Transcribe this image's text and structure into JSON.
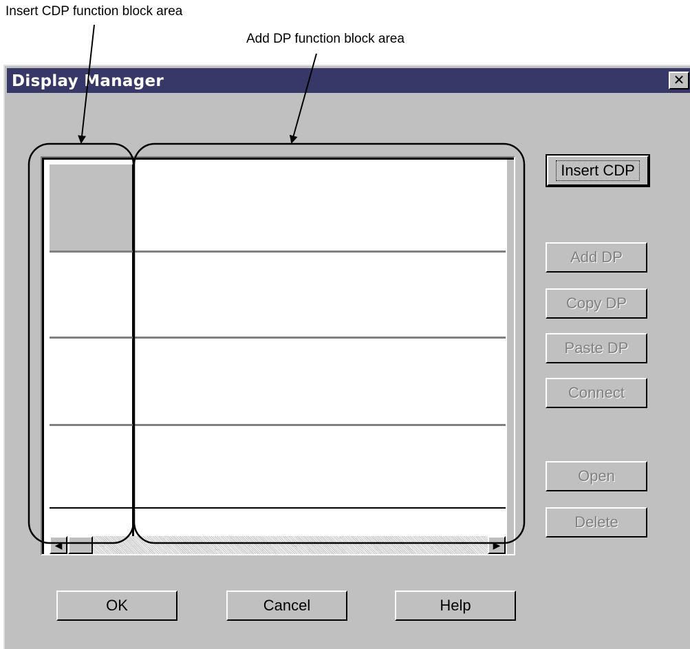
{
  "annotations": {
    "cdp_area": "Insert CDP function block area",
    "dp_area": "Add DP function block area"
  },
  "window": {
    "title": "Display Manager",
    "close_glyph": "✕"
  },
  "buttons": {
    "insert_cdp": "Insert CDP",
    "add_dp": "Add DP",
    "copy_dp": "Copy DP",
    "paste_dp": "Paste DP",
    "connect": "Connect",
    "open": "Open",
    "delete": "Delete",
    "ok": "OK",
    "cancel": "Cancel",
    "help": "Help"
  },
  "scrollbar": {
    "left_arrow": "◀",
    "right_arrow": "▶"
  },
  "colors": {
    "title_bar": "#383868",
    "face": "#c0c0c0",
    "disabled_text": "#808080"
  }
}
